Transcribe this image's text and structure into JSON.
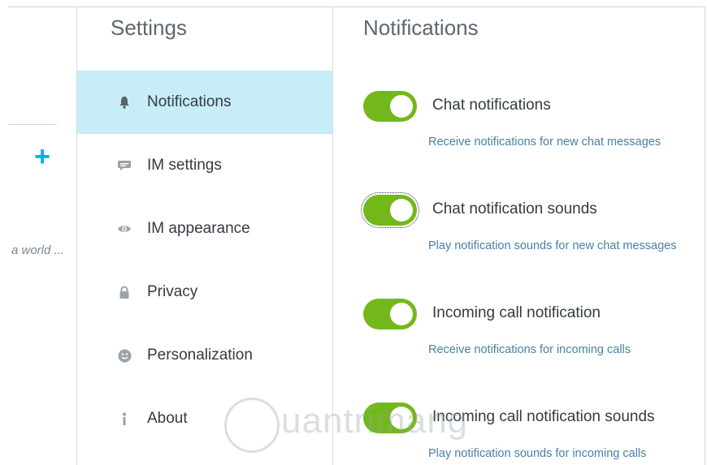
{
  "left_panel": {
    "add_icon": "plus-icon",
    "snippet": "a world ..."
  },
  "sidebar": {
    "title": "Settings",
    "items": [
      {
        "label": "Notifications",
        "icon": "bell-icon",
        "active": true
      },
      {
        "label": "IM settings",
        "icon": "chat-bubble-icon",
        "active": false
      },
      {
        "label": "IM appearance",
        "icon": "eye-icon",
        "active": false
      },
      {
        "label": "Privacy",
        "icon": "lock-icon",
        "active": false
      },
      {
        "label": "Personalization",
        "icon": "smiley-icon",
        "active": false
      },
      {
        "label": "About",
        "icon": "info-icon",
        "active": false
      }
    ]
  },
  "main": {
    "title": "Notifications",
    "settings": [
      {
        "label": "Chat notifications",
        "description": "Receive notifications for new chat messages",
        "enabled": true
      },
      {
        "label": "Chat notification sounds",
        "description": "Play notification sounds for new chat messages",
        "enabled": true
      },
      {
        "label": "Incoming call notification",
        "description": "Receive notifications for incoming calls",
        "enabled": true
      },
      {
        "label": "Incoming call notification sounds",
        "description": "Play notification sounds for incoming calls",
        "enabled": true
      }
    ]
  },
  "watermark": {
    "text": "uantrimang"
  },
  "colors": {
    "accent": "#00aff0",
    "toggle_on": "#73b81a",
    "active_item_bg": "#c8ecf8",
    "description_text": "#4a7fa8"
  }
}
